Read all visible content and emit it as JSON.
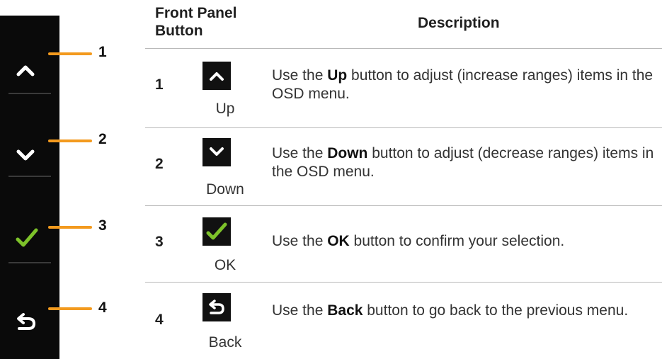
{
  "table": {
    "col1_header": "Front Panel Button",
    "col2_header": "Description"
  },
  "panel": {
    "callouts": [
      "1",
      "2",
      "3",
      "4"
    ],
    "accent_color": "#f39a1e",
    "check_color": "#7dc22a"
  },
  "rows": [
    {
      "num": "1",
      "icon": "chevron-up-icon",
      "label": "Up",
      "desc_pre": "Use the ",
      "desc_bold": "Up",
      "desc_post": " button to adjust (increase ranges) items in the OSD menu."
    },
    {
      "num": "2",
      "icon": "chevron-down-icon",
      "label": "Down",
      "desc_pre": "Use the ",
      "desc_bold": "Down",
      "desc_post": " button to adjust (decrease ranges) items in the OSD menu."
    },
    {
      "num": "3",
      "icon": "checkmark-icon",
      "label": "OK",
      "desc_pre": "Use the ",
      "desc_bold": "OK",
      "desc_post": " button to confirm your selection."
    },
    {
      "num": "4",
      "icon": "back-arrow-icon",
      "label": "Back",
      "desc_pre": "Use the ",
      "desc_bold": "Back",
      "desc_post": " button to go back to the previous menu."
    }
  ]
}
